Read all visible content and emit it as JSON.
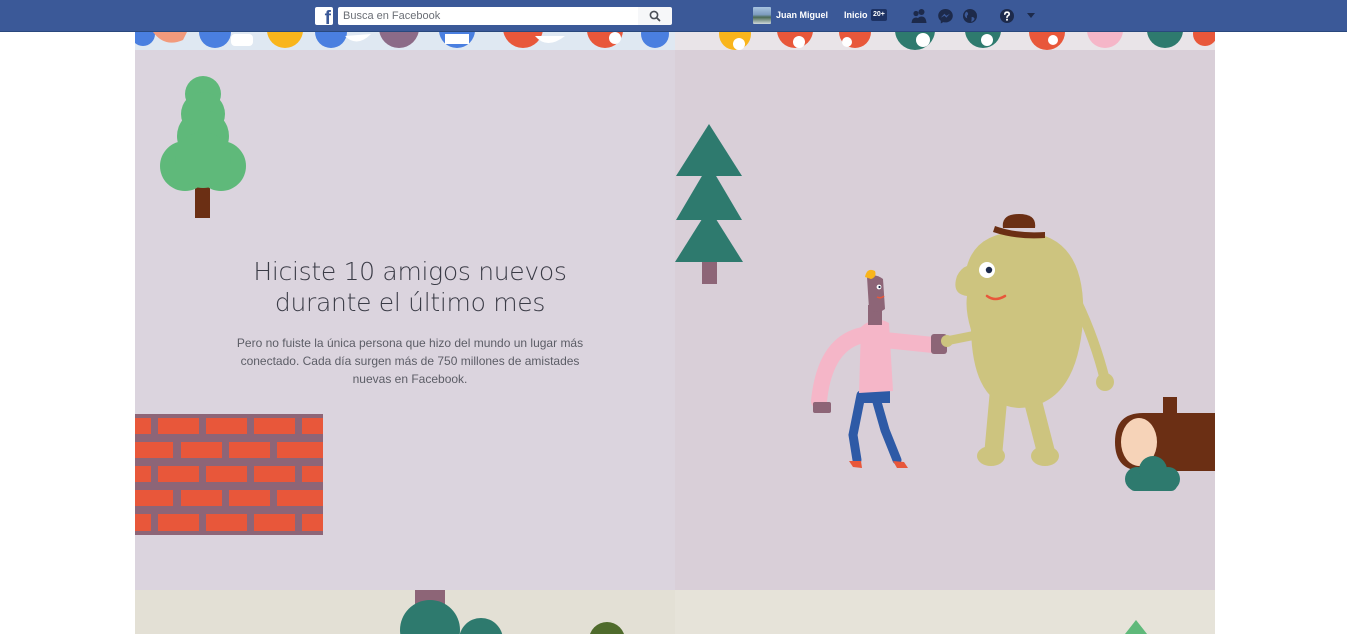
{
  "topbar": {
    "logo_letter": "f",
    "search": {
      "placeholder": "Busca en Facebook",
      "value": ""
    },
    "user": {
      "name": "Juan Miguel"
    },
    "home": {
      "label": "Inicio",
      "badge": "20+"
    },
    "icons": [
      "friend-requests-icon",
      "messenger-icon",
      "notifications-globe-icon",
      "help-icon",
      "account-menu-caret-icon"
    ],
    "colors": {
      "bar": "#3b5998",
      "bar_border": "#29487d"
    }
  },
  "card": {
    "headline_line1": "Hiciste 10 amigos nuevos",
    "headline_line2": "durante el último mes",
    "body_line1": "Pero no fuiste la única persona que hizo del mundo un lugar más",
    "body_line2": "conectado. Cada día surgen más de 750 millones de amistades",
    "body_line3": "nuevas en Facebook."
  },
  "illustration": {
    "colors": {
      "panel_left": "#dbd4de",
      "panel_right": "#d9cfd8",
      "tree_green": "#5fb97a",
      "pine": "#2e7a6e",
      "brick": "#e8573a",
      "mortar": "#8d6577",
      "monster": "#cdc47f",
      "shirt": "#f5b6c8",
      "jeans": "#2e5aa6",
      "log": "#6b2f14",
      "bush": "#2e7a6e"
    }
  }
}
